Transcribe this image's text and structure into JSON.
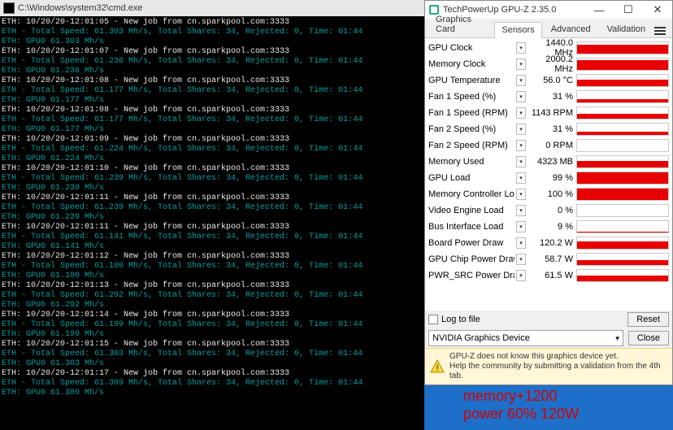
{
  "cmd": {
    "title": "C:\\Windows\\system32\\cmd.exe",
    "lines": [
      {
        "c": "w",
        "t": "ETH: 10/20/20-12:01:05 - New job from cn.sparkpool.com:3333"
      },
      {
        "c": "c",
        "t": "ETH - Total Speed: 61.303 Mh/s, Total Shares: 34, Rejected: 0, Time: 01:44"
      },
      {
        "c": "c",
        "t": "ETH: GPU0 61.303 Mh/s"
      },
      {
        "c": "w",
        "t": "ETH: 10/20/20-12:01:07 - New job from cn.sparkpool.com:3333"
      },
      {
        "c": "c",
        "t": "ETH - Total Speed: 61.236 Mh/s, Total Shares: 34, Rejected: 0, Time: 01:44"
      },
      {
        "c": "c",
        "t": "ETH: GPU0 61.236 Mh/s"
      },
      {
        "c": "w",
        "t": "ETH: 10/20/20-12:01:08 - New job from cn.sparkpool.com:3333"
      },
      {
        "c": "c",
        "t": "ETH - Total Speed: 61.177 Mh/s, Total Shares: 34, Rejected: 0, Time: 01:44"
      },
      {
        "c": "c",
        "t": "ETH: GPU0 61.177 Mh/s"
      },
      {
        "c": "w",
        "t": "ETH: 10/20/20-12:01:08 - New job from cn.sparkpool.com:3333"
      },
      {
        "c": "c",
        "t": "ETH - Total Speed: 61.177 Mh/s, Total Shares: 34, Rejected: 0, Time: 01:44"
      },
      {
        "c": "c",
        "t": "ETH: GPU0 61.177 Mh/s"
      },
      {
        "c": "w",
        "t": "ETH: 10/20/20-12:01:09 - New job from cn.sparkpool.com:3333"
      },
      {
        "c": "c",
        "t": "ETH - Total Speed: 61.224 Mh/s, Total Shares: 34, Rejected: 0, Time: 01:44"
      },
      {
        "c": "c",
        "t": "ETH: GPU0 61.224 Mh/s"
      },
      {
        "c": "w",
        "t": "ETH: 10/20/20-12:01:10 - New job from cn.sparkpool.com:3333"
      },
      {
        "c": "c",
        "t": "ETH - Total Speed: 61.239 Mh/s, Total Shares: 34, Rejected: 0, Time: 01:44"
      },
      {
        "c": "c",
        "t": "ETH: GPU0 61.239 Mh/s"
      },
      {
        "c": "w",
        "t": "ETH: 10/20/20-12:01:11 - New job from cn.sparkpool.com:3333"
      },
      {
        "c": "c",
        "t": "ETH - Total Speed: 61.239 Mh/s, Total Shares: 34, Rejected: 0, Time: 01:44"
      },
      {
        "c": "c",
        "t": "ETH: GPU0 61.239 Mh/s"
      },
      {
        "c": "w",
        "t": "ETH: 10/20/20-12:01:11 - New job from cn.sparkpool.com:3333"
      },
      {
        "c": "c",
        "t": "ETH - Total Speed: 61.141 Mh/s, Total Shares: 34, Rejected: 0, Time: 01:44"
      },
      {
        "c": "c",
        "t": "ETH: GPU0 61.141 Mh/s"
      },
      {
        "c": "w",
        "t": "ETH: 10/20/20-12:01:12 - New job from cn.sparkpool.com:3333"
      },
      {
        "c": "c",
        "t": "ETH - Total Speed: 61.100 Mh/s, Total Shares: 34, Rejected: 0, Time: 01:44"
      },
      {
        "c": "c",
        "t": "ETH: GPU0 61.100 Mh/s"
      },
      {
        "c": "w",
        "t": "ETH: 10/20/20-12:01:13 - New job from cn.sparkpool.com:3333"
      },
      {
        "c": "c",
        "t": "ETH - Total Speed: 61.292 Mh/s, Total Shares: 34, Rejected: 0, Time: 01:44"
      },
      {
        "c": "c",
        "t": "ETH: GPU0 61.292 Mh/s"
      },
      {
        "c": "w",
        "t": "ETH: 10/20/20-12:01:14 - New job from cn.sparkpool.com:3333"
      },
      {
        "c": "c",
        "t": "ETH - Total Speed: 61.199 Mh/s, Total Shares: 34, Rejected: 0, Time: 01:44"
      },
      {
        "c": "c",
        "t": "ETH: GPU0 61.199 Mh/s"
      },
      {
        "c": "w",
        "t": "ETH: 10/20/20-12:01:15 - New job from cn.sparkpool.com:3333"
      },
      {
        "c": "c",
        "t": "ETH - Total Speed: 61.303 Mh/s, Total Shares: 34, Rejected: 0, Time: 01:44"
      },
      {
        "c": "c",
        "t": "ETH: GPU0 61.303 Mh/s"
      },
      {
        "c": "w",
        "t": "ETH: 10/20/20-12:01:17 - New job from cn.sparkpool.com:3333"
      },
      {
        "c": "c",
        "t": "ETH - Total Speed: 61.309 Mh/s, Total Shares: 34, Rejected: 0, Time: 01:44"
      },
      {
        "c": "c",
        "t": "ETH: GPU0 61.309 Mh/s"
      }
    ]
  },
  "gpuz": {
    "title": "TechPowerUp GPU-Z 2.35.0",
    "tabs": [
      "Graphics Card",
      "Sensors",
      "Advanced",
      "Validation"
    ],
    "activeTab": 1,
    "sensors": [
      {
        "label": "GPU Clock",
        "value": "1440.0 MHz",
        "fill": 80
      },
      {
        "label": "Memory Clock",
        "value": "2000.2 MHz",
        "fill": 85
      },
      {
        "label": "GPU Temperature",
        "value": "56.0 °C",
        "fill": 55
      },
      {
        "label": "Fan 1 Speed (%)",
        "value": "31 %",
        "fill": 31
      },
      {
        "label": "Fan 1 Speed (RPM)",
        "value": "1143 RPM",
        "fill": 40
      },
      {
        "label": "Fan 2 Speed (%)",
        "value": "31 %",
        "fill": 31
      },
      {
        "label": "Fan 2 Speed (RPM)",
        "value": "0 RPM",
        "fill": 0
      },
      {
        "label": "Memory Used",
        "value": "4323 MB",
        "fill": 55
      },
      {
        "label": "GPU Load",
        "value": "99 %",
        "fill": 99
      },
      {
        "label": "Memory Controller Load",
        "value": "100 %",
        "fill": 100
      },
      {
        "label": "Video Engine Load",
        "value": "0 %",
        "fill": 0
      },
      {
        "label": "Bus Interface Load",
        "value": "9 %",
        "fill": 9
      },
      {
        "label": "Board Power Draw",
        "value": "120.2 W",
        "fill": 65
      },
      {
        "label": "GPU Chip Power Draw",
        "value": "58.7 W",
        "fill": 45
      },
      {
        "label": "PWR_SRC Power Draw",
        "value": "61.5 W",
        "fill": 48
      }
    ],
    "logLabel": "Log to file",
    "resetLabel": "Reset",
    "device": "NVIDIA Graphics Device",
    "closeLabel": "Close",
    "warn1": "GPU-Z does not know this graphics device yet.",
    "warn2": "Help the community by submitting a validation from the 4th tab."
  },
  "overlay": {
    "line1": "memory+1200",
    "line2": "power 60% 120W"
  }
}
